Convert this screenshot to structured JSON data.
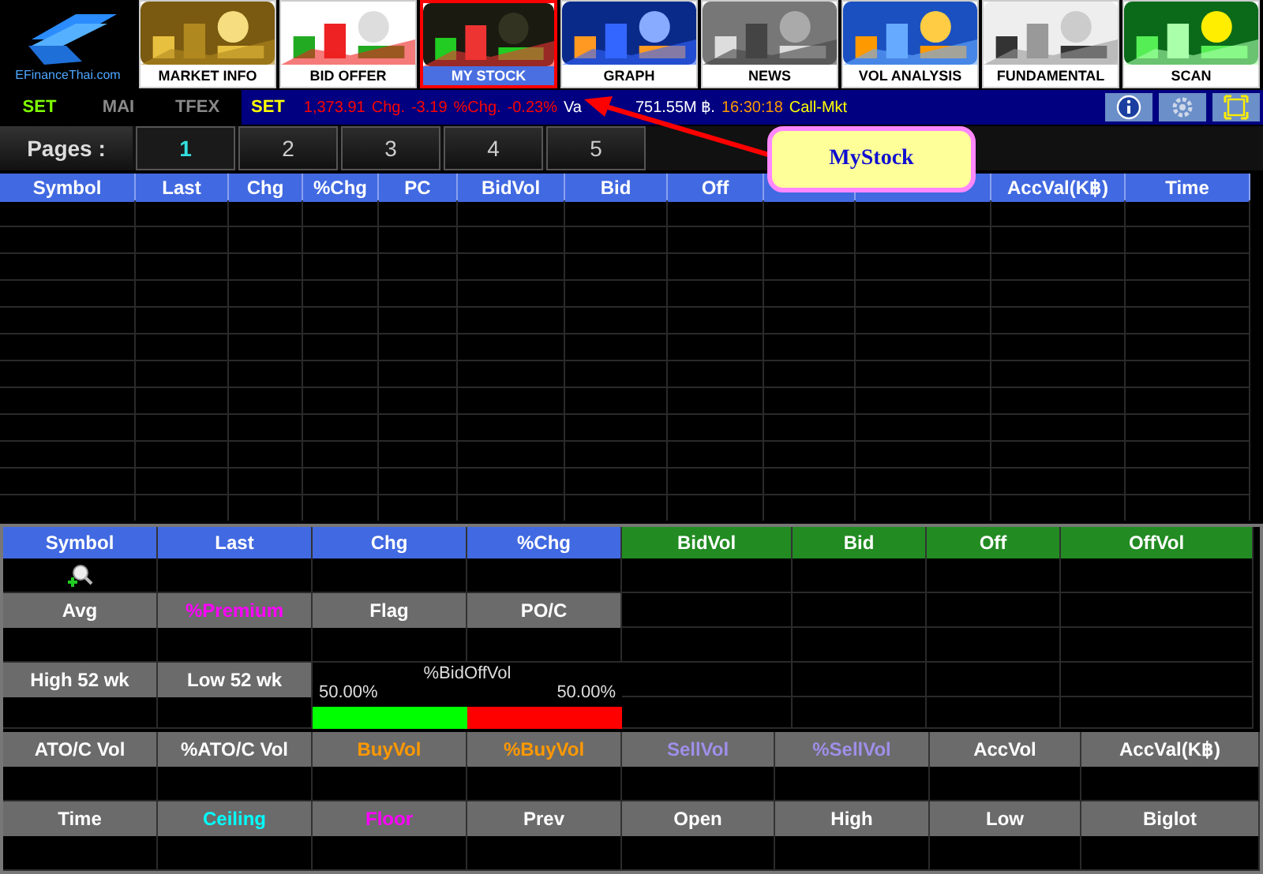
{
  "logo": {
    "text": "EFinanceThai.com"
  },
  "nav_tiles": [
    {
      "label": "MARKET INFO",
      "selected": false
    },
    {
      "label": "BID OFFER",
      "selected": false
    },
    {
      "label": "MY STOCK",
      "selected": true
    },
    {
      "label": "GRAPH",
      "selected": false
    },
    {
      "label": "NEWS",
      "selected": false
    },
    {
      "label": "VOL ANALYSIS",
      "selected": false
    },
    {
      "label": "FUNDAMENTAL",
      "selected": false
    },
    {
      "label": "SCAN",
      "selected": false
    }
  ],
  "market_tabs": [
    {
      "label": "SET",
      "selected": true
    },
    {
      "label": "MAI",
      "selected": false
    },
    {
      "label": "TFEX",
      "selected": false
    }
  ],
  "ticker": [
    {
      "text": "SET",
      "color": "#ffff00"
    },
    {
      "text": "1,373.91",
      "color": "#ff0000"
    },
    {
      "text": "Chg.",
      "color": "#ff0000"
    },
    {
      "text": "-3.19",
      "color": "#ff0000"
    },
    {
      "text": "%Chg.",
      "color": "#ff0000"
    },
    {
      "text": "-0.23%",
      "color": "#ff0000"
    },
    {
      "text": "Va",
      "color": "#ffffff"
    },
    {
      "text": "751.55M ฿.",
      "color": "#ffffff"
    },
    {
      "text": "16:30:18",
      "color": "#ff9900"
    },
    {
      "text": "Call-Mkt",
      "color": "#ffff00"
    }
  ],
  "pages": {
    "label": "Pages :",
    "tabs": [
      {
        "label": "1",
        "selected": true
      },
      {
        "label": "2",
        "selected": false
      },
      {
        "label": "3",
        "selected": false
      },
      {
        "label": "4",
        "selected": false
      },
      {
        "label": "5",
        "selected": false
      }
    ]
  },
  "table": {
    "columns": [
      {
        "label": "Symbol"
      },
      {
        "label": "Last"
      },
      {
        "label": "Chg"
      },
      {
        "label": "%Chg"
      },
      {
        "label": "PC"
      },
      {
        "label": "BidVol"
      },
      {
        "label": "Bid"
      },
      {
        "label": "Off"
      },
      {},
      {},
      {
        "label": "AccVal(K฿)"
      },
      {
        "label": "Time"
      }
    ]
  },
  "callout": {
    "text": "MyStock"
  },
  "quote_panel": {
    "price_headers": [
      {
        "label": "Symbol"
      },
      {
        "label": "Last"
      },
      {
        "label": "Chg"
      },
      {
        "label": "%Chg"
      }
    ],
    "depth_headers": [
      {
        "label": "BidVol"
      },
      {
        "label": "Bid"
      },
      {
        "label": "Off"
      },
      {
        "label": "OffVol"
      }
    ],
    "info_headers": [
      {
        "label": "Avg",
        "color": "#ffffff"
      },
      {
        "label": "%Premium",
        "color": "#ff00ff"
      },
      {
        "label": "Flag",
        "color": "#ffffff"
      },
      {
        "label": "PO/C",
        "color": "#ffffff"
      }
    ],
    "range_headers": [
      {
        "label": "High 52 wk"
      },
      {
        "label": "Low 52 wk"
      }
    ],
    "bid_off_vol": {
      "title": "%BidOffVol",
      "bid_percent": "50.00%",
      "off_percent": "50.00%",
      "level": 0.5
    },
    "volume_headers": [
      {
        "label": "ATO/C Vol",
        "color": "#ffffff"
      },
      {
        "label": "%ATO/C Vol",
        "color": "#ffffff"
      },
      {
        "label": "BuyVol",
        "color": "#ff9900"
      },
      {
        "label": "%BuyVol",
        "color": "#ff9900"
      },
      {
        "label": "SellVol",
        "color": "#9f8fe8"
      },
      {
        "label": "%SellVol",
        "color": "#9f8fe8"
      },
      {
        "label": "AccVol",
        "color": "#ffffff"
      },
      {
        "label": "AccVal(K฿)",
        "color": "#ffffff"
      }
    ],
    "price_limit_headers": [
      {
        "label": "Time",
        "color": "#ffffff"
      },
      {
        "label": "Ceiling",
        "color": "#00ffff"
      },
      {
        "label": "Floor",
        "color": "#ff00ff"
      },
      {
        "label": "Prev",
        "color": "#ffffff"
      },
      {
        "label": "Open",
        "color": "#ffffff"
      },
      {
        "label": "High",
        "color": "#ffffff"
      },
      {
        "label": "Low",
        "color": "#ffffff"
      },
      {
        "label": "Biglot",
        "color": "#ffffff"
      }
    ]
  }
}
